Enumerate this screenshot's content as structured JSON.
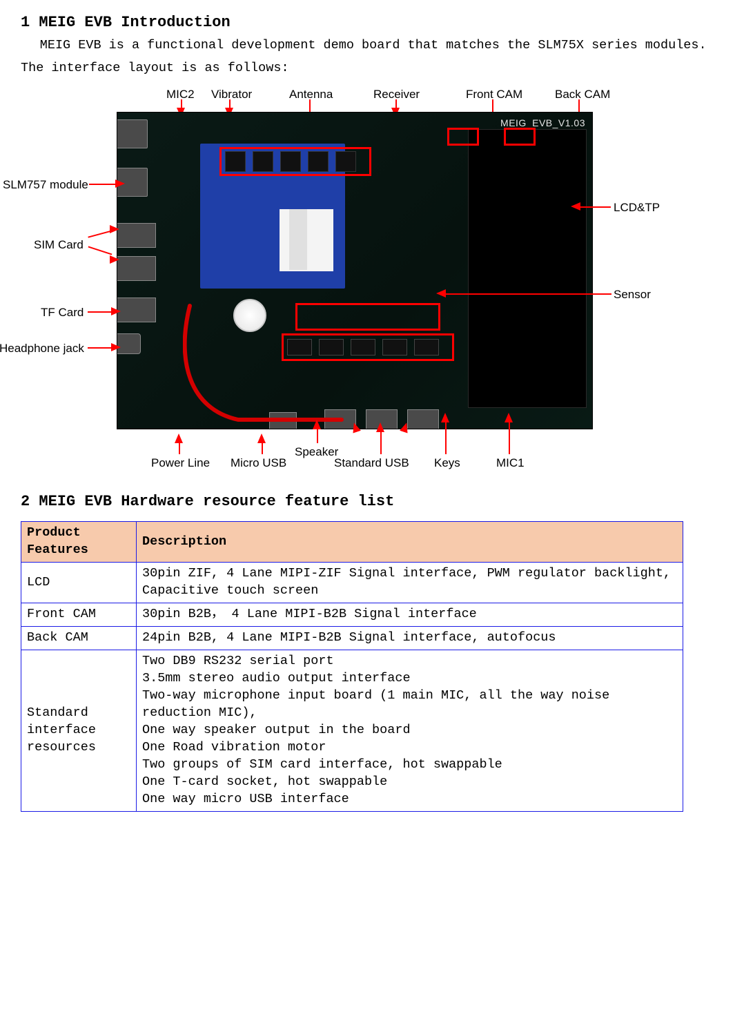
{
  "section1": {
    "heading": "1  MEIG EVB Introduction",
    "line1": "MEIG EVB is a functional development demo board that matches the SLM75X series modules.",
    "line2": "The interface layout is as follows:"
  },
  "fig": {
    "silk": "MEIG_EVB_V1.03",
    "top": {
      "mic2": "MIC2",
      "vibrator": "Vibrator",
      "antenna": "Antenna",
      "receiver": "Receiver",
      "frontcam": "Front CAM",
      "backcam": "Back CAM"
    },
    "left": {
      "slm757": "SLM757 module",
      "sim": "SIM Card",
      "tf": "TF Card",
      "hp": "Headphone jack"
    },
    "right": {
      "lcdtp": "LCD&TP",
      "sensor": "Sensor"
    },
    "bottom": {
      "power": "Power Line",
      "microusb": "Micro USB",
      "speaker": "Speaker",
      "stdusb": "Standard USB",
      "keys": "Keys",
      "mic1": "MIC1"
    }
  },
  "section2": {
    "heading": "2  MEIG EVB Hardware resource feature list"
  },
  "table": {
    "h1": "Product Features",
    "h2": "Description",
    "rows": [
      {
        "f": "LCD",
        "d": "30pin ZIF, 4 Lane MIPI-ZIF Signal interface, PWM regulator backlight, Capacitive touch screen"
      },
      {
        "f": "Front CAM",
        "d": "30pin B2B， 4 Lane MIPI-B2B Signal interface"
      },
      {
        "f": "Back CAM",
        "d": "24pin B2B, 4 Lane MIPI-B2B Signal interface, autofocus"
      },
      {
        "f": "Standard interface resources",
        "d": "Two DB9 RS232 serial port\n3.5mm stereo audio output interface\nTwo-way microphone input board (1 main MIC, all the way noise reduction MIC),\nOne way speaker output in the board\nOne Road vibration motor\nTwo groups of SIM card interface, hot swappable\nOne T-card socket, hot swappable\nOne way micro USB interface"
      }
    ]
  }
}
